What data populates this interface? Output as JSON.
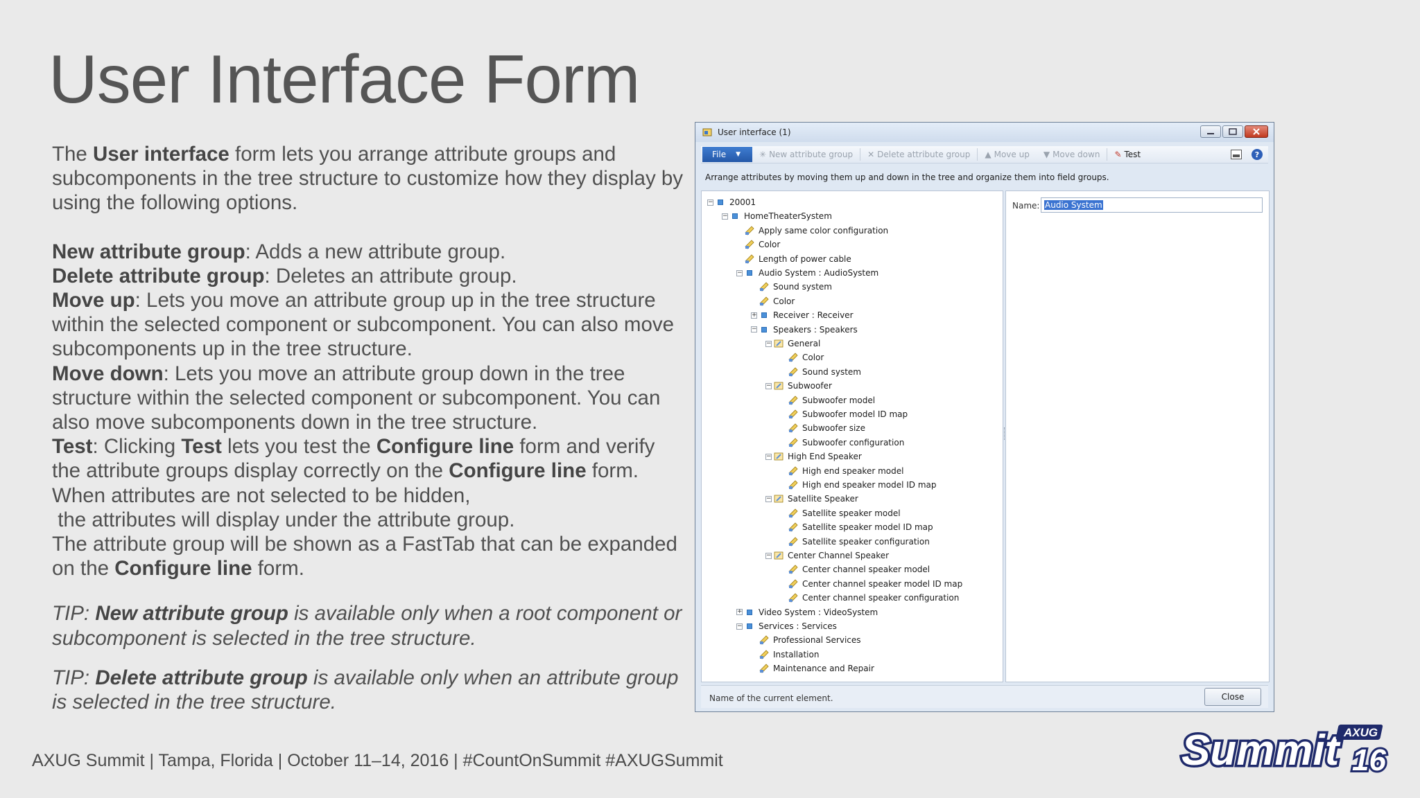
{
  "slide": {
    "title": "User Interface Form",
    "intro": {
      "p1": "The ",
      "b1": "User interface",
      "p2": " form lets you arrange attribute groups and subcomponents in the tree structure to customize how they display by using the following options."
    },
    "options": {
      "new_b": "New attribute group",
      "new_t": ": Adds a new attribute group.",
      "del_b": "Delete attribute group",
      "del_t": ":  Deletes an attribute group.",
      "up_b": "Move up",
      "up_t": ": Lets you move an attribute group up in the tree structure within the selected component or subcomponent. You can also move subcomponents up in the tree structure.",
      "down_b": "Move down",
      "down_t": ": Lets you move an attribute group down in the tree structure within the selected component or subcomponent. You can also move subcomponents down in the tree structure.",
      "test_b": "Test",
      "test_t1": ": Clicking ",
      "test_b2": "Test",
      "test_t2": " lets you test the ",
      "test_b3": "Configure line",
      "test_t3": " form and verify the attribute groups display correctly on the ",
      "test_b4": "Configure line",
      "test_t4": " form.",
      "hidden_1": "When attributes are not selected to be hidden,",
      "hidden_2": " the attributes will display under the attribute group.",
      "fasttab_1": "The attribute group will be shown as a FastTab that can be expanded on the ",
      "fasttab_b": "Configure line",
      "fasttab_2": " form."
    },
    "tips": {
      "tip1_label": "TIP",
      "tip1_b": "New attribute group",
      "tip1_t": " is available only when a root component or subcomponent is selected in the tree structure.",
      "tip2_label": "TIP",
      "tip2_b": "Delete attribute group",
      "tip2_t": " is available only when an attribute group is selected in the tree structure."
    },
    "footer": "AXUG Summit | Tampa, Florida | October 11–14, 2016 | #CountOnSummit  #AXUGSummit",
    "logo": {
      "word": "Summit",
      "tag": "AXUG",
      "year": "16"
    }
  },
  "window": {
    "title": "User interface (1)",
    "toolbar": {
      "file": "File",
      "new_group": "New attribute group",
      "delete_group": "Delete attribute group",
      "move_up": "Move up",
      "move_down": "Move down",
      "test": "Test"
    },
    "instruction": "Arrange attributes by moving them up and down in the tree and organize them into field groups.",
    "name_label": "Name:",
    "name_value": "Audio System",
    "status": "Name of the current element.",
    "close": "Close",
    "tree": [
      {
        "label": "20001",
        "level": 0,
        "icon": "comp",
        "exp": "-"
      },
      {
        "label": "HomeTheaterSystem",
        "level": 1,
        "icon": "comp",
        "exp": "-"
      },
      {
        "label": "Apply same color configuration",
        "level": 2,
        "icon": "attr",
        "exp": ""
      },
      {
        "label": "Color",
        "level": 2,
        "icon": "attr",
        "exp": ""
      },
      {
        "label": "Length of power cable",
        "level": 2,
        "icon": "attr",
        "exp": ""
      },
      {
        "label": "Audio System : AudioSystem",
        "level": 2,
        "icon": "comp",
        "exp": "-"
      },
      {
        "label": "Sound system",
        "level": 3,
        "icon": "attr",
        "exp": ""
      },
      {
        "label": "Color",
        "level": 3,
        "icon": "attr",
        "exp": ""
      },
      {
        "label": "Receiver : Receiver",
        "level": 3,
        "icon": "comp",
        "exp": "+"
      },
      {
        "label": "Speakers : Speakers",
        "level": 3,
        "icon": "comp",
        "exp": "-"
      },
      {
        "label": "General",
        "level": 4,
        "icon": "grp",
        "exp": "-"
      },
      {
        "label": "Color",
        "level": 5,
        "icon": "attr",
        "exp": ""
      },
      {
        "label": "Sound system",
        "level": 5,
        "icon": "attr",
        "exp": ""
      },
      {
        "label": "Subwoofer",
        "level": 4,
        "icon": "grp",
        "exp": "-"
      },
      {
        "label": "Subwoofer model",
        "level": 5,
        "icon": "attr",
        "exp": ""
      },
      {
        "label": "Subwoofer model ID map",
        "level": 5,
        "icon": "attr",
        "exp": ""
      },
      {
        "label": "Subwoofer size",
        "level": 5,
        "icon": "attr",
        "exp": ""
      },
      {
        "label": "Subwoofer configuration",
        "level": 5,
        "icon": "attr",
        "exp": ""
      },
      {
        "label": "High End Speaker",
        "level": 4,
        "icon": "grp",
        "exp": "-"
      },
      {
        "label": "High end speaker model",
        "level": 5,
        "icon": "attr",
        "exp": ""
      },
      {
        "label": "High end speaker model  ID map",
        "level": 5,
        "icon": "attr",
        "exp": ""
      },
      {
        "label": "Satellite Speaker",
        "level": 4,
        "icon": "grp",
        "exp": "-"
      },
      {
        "label": "Satellite speaker model",
        "level": 5,
        "icon": "attr",
        "exp": ""
      },
      {
        "label": "Satellite speaker model ID map",
        "level": 5,
        "icon": "attr",
        "exp": ""
      },
      {
        "label": "Satellite speaker configuration",
        "level": 5,
        "icon": "attr",
        "exp": ""
      },
      {
        "label": "Center Channel Speaker",
        "level": 4,
        "icon": "grp",
        "exp": "-"
      },
      {
        "label": "Center channel speaker model",
        "level": 5,
        "icon": "attr",
        "exp": ""
      },
      {
        "label": "Center channel speaker model ID map",
        "level": 5,
        "icon": "attr",
        "exp": ""
      },
      {
        "label": "Center channel speaker configuration",
        "level": 5,
        "icon": "attr",
        "exp": ""
      },
      {
        "label": "Video System : VideoSystem",
        "level": 2,
        "icon": "comp",
        "exp": "+"
      },
      {
        "label": "Services : Services",
        "level": 2,
        "icon": "comp",
        "exp": "-"
      },
      {
        "label": "Professional Services",
        "level": 3,
        "icon": "attr",
        "exp": ""
      },
      {
        "label": "Installation",
        "level": 3,
        "icon": "attr",
        "exp": ""
      },
      {
        "label": "Maintenance and Repair",
        "level": 3,
        "icon": "attr",
        "exp": ""
      }
    ]
  },
  "colors": {
    "accent": "#2458a8",
    "logo_navy": "#1f2a6b",
    "selection": "#3a73d1"
  }
}
